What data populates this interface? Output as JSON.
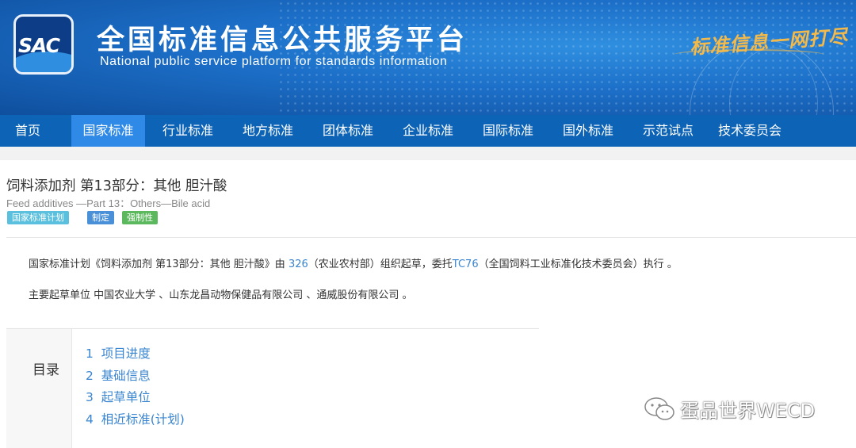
{
  "header": {
    "logo_text": "SAC",
    "title": "全国标准信息公共服务平台",
    "subtitle": "National public service platform  for standards information",
    "slogan": "标准信息一网打尽"
  },
  "nav": {
    "items": [
      {
        "label": "首页",
        "active": false
      },
      {
        "label": "国家标准",
        "active": true
      },
      {
        "label": "行业标准",
        "active": false
      },
      {
        "label": "地方标准",
        "active": false
      },
      {
        "label": "团体标准",
        "active": false
      },
      {
        "label": "企业标准",
        "active": false
      },
      {
        "label": "国际标准",
        "active": false
      },
      {
        "label": "国外标准",
        "active": false
      },
      {
        "label": "示范试点",
        "active": false
      },
      {
        "label": "技术委员会",
        "active": false
      }
    ]
  },
  "standard": {
    "title_cn": "饲料添加剂 第13部分：其他 胆汁酸",
    "title_en": "Feed additives —Part 13：Others—Bile acid",
    "badges": [
      {
        "label": "国家标准计划",
        "color": "#5bc0de"
      },
      {
        "label": "制定",
        "color": "#4a90d9"
      },
      {
        "label": "强制性",
        "color": "#5cb85c"
      }
    ]
  },
  "description": {
    "line1_prefix": "国家标准计划《饲料添加剂 第13部分：其他 胆汁酸》由 ",
    "line1_org_code": "326",
    "line1_mid": "（农业农村部）组织起草，委托",
    "line1_tc_code": "TC76",
    "line1_suffix": "（全国饲料工业标准化技术委员会）执行 。",
    "line2": "主要起草单位 中国农业大学 、山东龙昌动物保健品有限公司 、通威股份有限公司 。"
  },
  "toc": {
    "heading": "目录",
    "items": [
      {
        "num": "1",
        "label": "项目进度"
      },
      {
        "num": "2",
        "label": "基础信息"
      },
      {
        "num": "3",
        "label": "起草单位"
      },
      {
        "num": "4",
        "label": "相近标准(计划)"
      }
    ]
  },
  "watermark": {
    "text": "蛋品世界WECD",
    "icon": "wechat-icon"
  },
  "colors": {
    "nav_bg": "#0d63b5",
    "nav_active": "#2e8ae6",
    "link": "#3a85d0"
  }
}
